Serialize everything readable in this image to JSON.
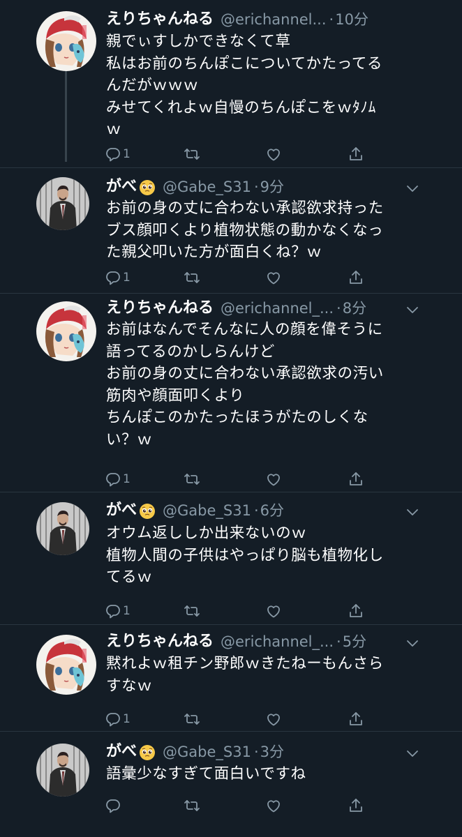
{
  "tweets": [
    {
      "display_name": "えりちゃんねる",
      "handle": "@erichannel...",
      "separator": "·",
      "time": "10分",
      "lines": [
        "親でぃすしかできなくて草",
        "私はお前のちんぽこについてかたってる",
        "んだがｗｗｗ",
        "みせてくれよｗ自慢のちんぽこをｗﾀﾉﾑ",
        "ｗ"
      ],
      "reply_count": "1"
    },
    {
      "display_name": "がべ",
      "handle": "@Gabe_S31",
      "separator": "·",
      "time": "9分",
      "lines": [
        "お前の身の丈に合わない承認欲求持った",
        "ブス顔叩くより植物状態の動かなくなっ",
        "た親父叩いた方が面白くね？ｗ"
      ],
      "reply_count": "1"
    },
    {
      "display_name": "えりちゃんねる",
      "handle": "@erichannel_...",
      "separator": "·",
      "time": "8分",
      "lines": [
        "お前はなんでそんなに人の顔を偉そうに",
        "語ってるのかしらんけど",
        "お前の身の丈に合わない承認欲求の汚い",
        "筋肉や顔面叩くより",
        "ちんぽこのかたったほうがたのしくな",
        "い？ｗ"
      ],
      "reply_count": "1"
    },
    {
      "display_name": "がべ",
      "handle": "@Gabe_S31",
      "separator": "·",
      "time": "6分",
      "lines": [
        "オウム返ししか出来ないのｗ",
        "植物人間の子供はやっぱり脳も植物化し",
        "てるｗ"
      ],
      "reply_count": "1"
    },
    {
      "display_name": "えりちゃんねる",
      "handle": "@erichannel_...",
      "separator": "·",
      "time": "5分",
      "lines": [
        "黙れよｗ租チン野郎ｗきたねーもんさら",
        "すなｗ"
      ],
      "reply_count": "1"
    },
    {
      "display_name": "がべ",
      "handle": "@Gabe_S31",
      "separator": "·",
      "time": "3分",
      "lines": [
        "語彙少なすぎて面白いですね"
      ],
      "reply_count": ""
    }
  ],
  "icons": {
    "reply": "reply-icon",
    "retweet": "retweet-icon",
    "like": "like-icon",
    "share": "share-icon",
    "more": "chevron-down-icon",
    "emoji": "pleading-face-emoji"
  },
  "colors": {
    "background": "#141d26",
    "text": "#ffffff",
    "secondary": "#8899a6",
    "divider": "#2a3640"
  }
}
